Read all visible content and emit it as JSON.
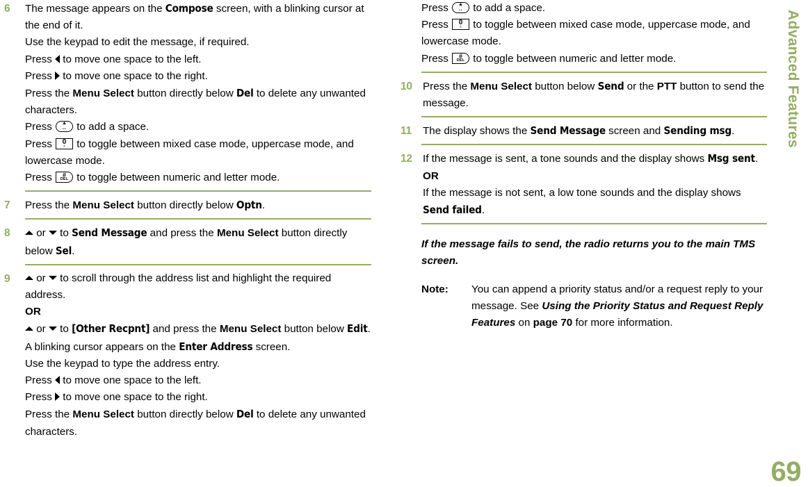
{
  "page": {
    "number": "69",
    "side_tab": "Advanced Features",
    "accent_color": "#93ae62"
  },
  "keys": {
    "star": {
      "main": "*",
      "sub": "··"
    },
    "zero": {
      "main": "0",
      "sub": "♁"
    },
    "hash_del": {
      "main": "#",
      "sub": "DEL"
    }
  },
  "left_column": {
    "step6": {
      "number": "6",
      "lines": [
        {
          "parts": [
            {
              "t": "The message appears on the "
            },
            {
              "t": "Compose",
              "s": "lcd"
            },
            {
              "t": " screen, with a blinking cursor at the end of it."
            }
          ]
        },
        {
          "parts": [
            {
              "t": "Use the keypad to edit the message, if required."
            }
          ]
        },
        {
          "parts": [
            {
              "t": "Press "
            },
            {
              "icon": "tri-lf"
            },
            {
              "t": " to move one space to the left."
            }
          ]
        },
        {
          "parts": [
            {
              "t": "Press "
            },
            {
              "icon": "tri-rt"
            },
            {
              "t": " to move one space to the right."
            }
          ]
        },
        {
          "parts": [
            {
              "t": "Press the "
            },
            {
              "t": "Menu Select",
              "s": "b"
            },
            {
              "t": " button directly below "
            },
            {
              "t": "Del",
              "s": "lcd"
            },
            {
              "t": " to delete any unwanted characters."
            }
          ]
        },
        {
          "parts": [
            {
              "t": "Press "
            },
            {
              "icon": "key-star"
            },
            {
              "t": " to add a space."
            }
          ]
        },
        {
          "parts": [
            {
              "t": "Press "
            },
            {
              "icon": "key-zero"
            },
            {
              "t": " to toggle between mixed case mode, uppercase mode, and lowercase mode."
            }
          ]
        },
        {
          "parts": [
            {
              "t": "Press "
            },
            {
              "icon": "key-del"
            },
            {
              "t": " to toggle between numeric and letter mode."
            }
          ]
        }
      ]
    },
    "step7": {
      "number": "7",
      "lines": [
        {
          "parts": [
            {
              "t": "Press the "
            },
            {
              "t": "Menu Select",
              "s": "b"
            },
            {
              "t": " button directly below "
            },
            {
              "t": "Optn",
              "s": "lcd"
            },
            {
              "t": "."
            }
          ]
        }
      ]
    },
    "step8": {
      "number": "8",
      "lines": [
        {
          "parts": [
            {
              "icon": "tri-up"
            },
            {
              "t": " or "
            },
            {
              "icon": "tri-dn"
            },
            {
              "t": " to "
            },
            {
              "t": "Send Message",
              "s": "lcd"
            },
            {
              "t": " and press the "
            },
            {
              "t": "Menu Select",
              "s": "b"
            },
            {
              "t": " button directly below "
            },
            {
              "t": "Sel",
              "s": "lcd"
            },
            {
              "t": "."
            }
          ]
        }
      ]
    },
    "step9": {
      "number": "9",
      "lines": [
        {
          "parts": [
            {
              "icon": "tri-up"
            },
            {
              "t": " or "
            },
            {
              "icon": "tri-dn"
            },
            {
              "t": " to scroll through the address list and highlight the required address."
            }
          ]
        },
        {
          "parts": [
            {
              "t": "OR",
              "s": "b"
            }
          ]
        },
        {
          "parts": [
            {
              "icon": "tri-up"
            },
            {
              "t": " or "
            },
            {
              "icon": "tri-dn"
            },
            {
              "t": " to "
            },
            {
              "t": "[Other Recpnt]",
              "s": "lcd"
            },
            {
              "t": " and press the "
            },
            {
              "t": "Menu Select",
              "s": "b"
            },
            {
              "t": " button below "
            },
            {
              "t": "Edit",
              "s": "lcd"
            },
            {
              "t": "."
            }
          ]
        },
        {
          "parts": [
            {
              "t": "A blinking cursor appears on the "
            },
            {
              "t": "Enter Address",
              "s": "lcd"
            },
            {
              "t": " screen."
            }
          ]
        },
        {
          "parts": [
            {
              "t": "Use the keypad to type the address entry."
            }
          ]
        },
        {
          "parts": [
            {
              "t": "Press "
            },
            {
              "icon": "tri-lf"
            },
            {
              "t": " to move one space to the left."
            }
          ]
        },
        {
          "parts": [
            {
              "t": "Press "
            },
            {
              "icon": "tri-rt"
            },
            {
              "t": " to move one space to the right."
            }
          ]
        },
        {
          "parts": [
            {
              "t": "Press the "
            },
            {
              "t": "Menu Select",
              "s": "b"
            },
            {
              "t": " button directly below "
            },
            {
              "t": "Del",
              "s": "lcd"
            },
            {
              "t": " to delete any unwanted characters."
            }
          ]
        }
      ]
    }
  },
  "right_column": {
    "step9_cont": {
      "lines": [
        {
          "parts": [
            {
              "t": "Press "
            },
            {
              "icon": "key-star"
            },
            {
              "t": " to add a space."
            }
          ]
        },
        {
          "parts": [
            {
              "t": "Press "
            },
            {
              "icon": "key-zero"
            },
            {
              "t": " to toggle between mixed case mode, uppercase mode, and lowercase mode."
            }
          ]
        },
        {
          "parts": [
            {
              "t": "Press "
            },
            {
              "icon": "key-del"
            },
            {
              "t": " to toggle between numeric and letter mode."
            }
          ]
        }
      ]
    },
    "step10": {
      "number": "10",
      "lines": [
        {
          "parts": [
            {
              "t": "Press the "
            },
            {
              "t": "Menu Select",
              "s": "b"
            },
            {
              "t": " button below "
            },
            {
              "t": "Send",
              "s": "lcd"
            },
            {
              "t": " or the "
            },
            {
              "t": "PTT",
              "s": "b"
            },
            {
              "t": " button to send the message."
            }
          ]
        }
      ]
    },
    "step11": {
      "number": "11",
      "lines": [
        {
          "parts": [
            {
              "t": "The display shows the "
            },
            {
              "t": "Send Message",
              "s": "lcd"
            },
            {
              "t": " screen and "
            },
            {
              "t": "Sending msg",
              "s": "lcd"
            },
            {
              "t": "."
            }
          ]
        }
      ]
    },
    "step12": {
      "number": "12",
      "lines": [
        {
          "parts": [
            {
              "t": "If the message is sent, a tone sounds and the display shows "
            },
            {
              "t": "Msg sent",
              "s": "lcd"
            },
            {
              "t": "."
            }
          ]
        },
        {
          "parts": [
            {
              "t": "OR",
              "s": "b"
            }
          ]
        },
        {
          "parts": [
            {
              "t": "If the message is not sent, a low tone sounds and the display shows "
            },
            {
              "t": "Send failed",
              "s": "lcd"
            },
            {
              "t": "."
            }
          ]
        }
      ]
    },
    "italic_note": "If the message fails to send, the radio returns you to the main TMS screen.",
    "note": {
      "label": "Note:",
      "parts": [
        {
          "t": "You can append a priority status and/or a request reply to your message. See "
        },
        {
          "t": "Using the Priority Status and Request Reply Features",
          "s": "bi"
        },
        {
          "t": " on "
        },
        {
          "t": "page 70",
          "s": "b"
        },
        {
          "t": " for more information."
        }
      ]
    }
  }
}
